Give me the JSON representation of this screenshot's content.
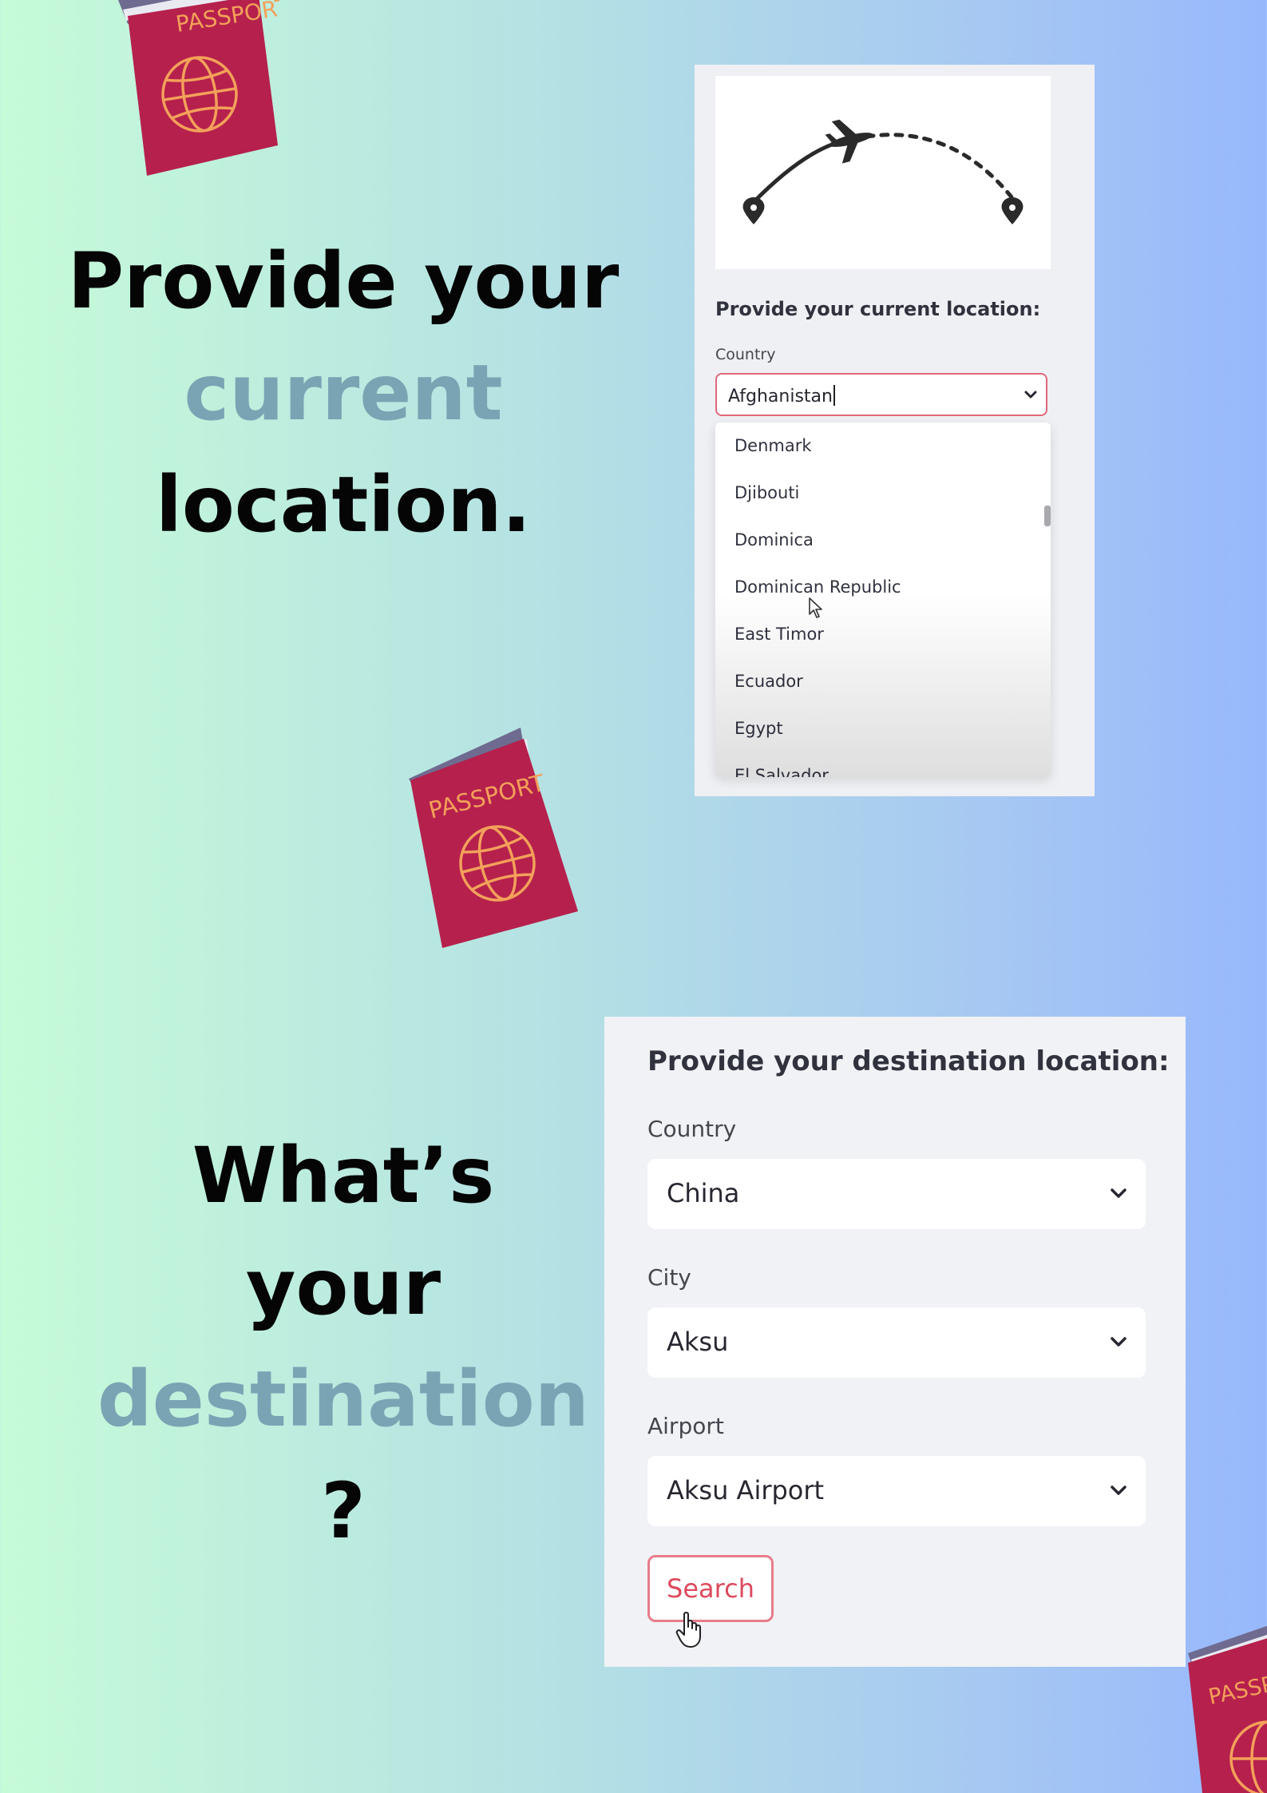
{
  "headline1": {
    "line1": "Provide your",
    "line2": "current",
    "line3": "location."
  },
  "headline2": {
    "line1": "What’s",
    "line2": "your",
    "line3": "destination",
    "line4": "?"
  },
  "passport_text": "PASSPORT",
  "current_panel": {
    "section_title": "Provide your current location:",
    "country_label": "Country",
    "country_value": "Afghanistan",
    "options": [
      "Denmark",
      "Djibouti",
      "Dominica",
      "Dominican Republic",
      "East Timor",
      "Ecuador",
      "Egypt",
      "El Salvador"
    ]
  },
  "destination_panel": {
    "section_title": "Provide your destination location:",
    "country_label": "Country",
    "country_value": "China",
    "city_label": "City",
    "city_value": "Aksu",
    "airport_label": "Airport",
    "airport_value": "Aksu Airport",
    "search_label": "Search"
  },
  "colors": {
    "accent_text": "#7aa3b3",
    "passport": "#b5204c",
    "search_border": "#e97c8a"
  },
  "icons": [
    "passport-icon",
    "airplane-route-icon",
    "map-pin-icon",
    "chevron-down-icon",
    "mouse-pointer-icon",
    "hand-cursor-icon"
  ]
}
